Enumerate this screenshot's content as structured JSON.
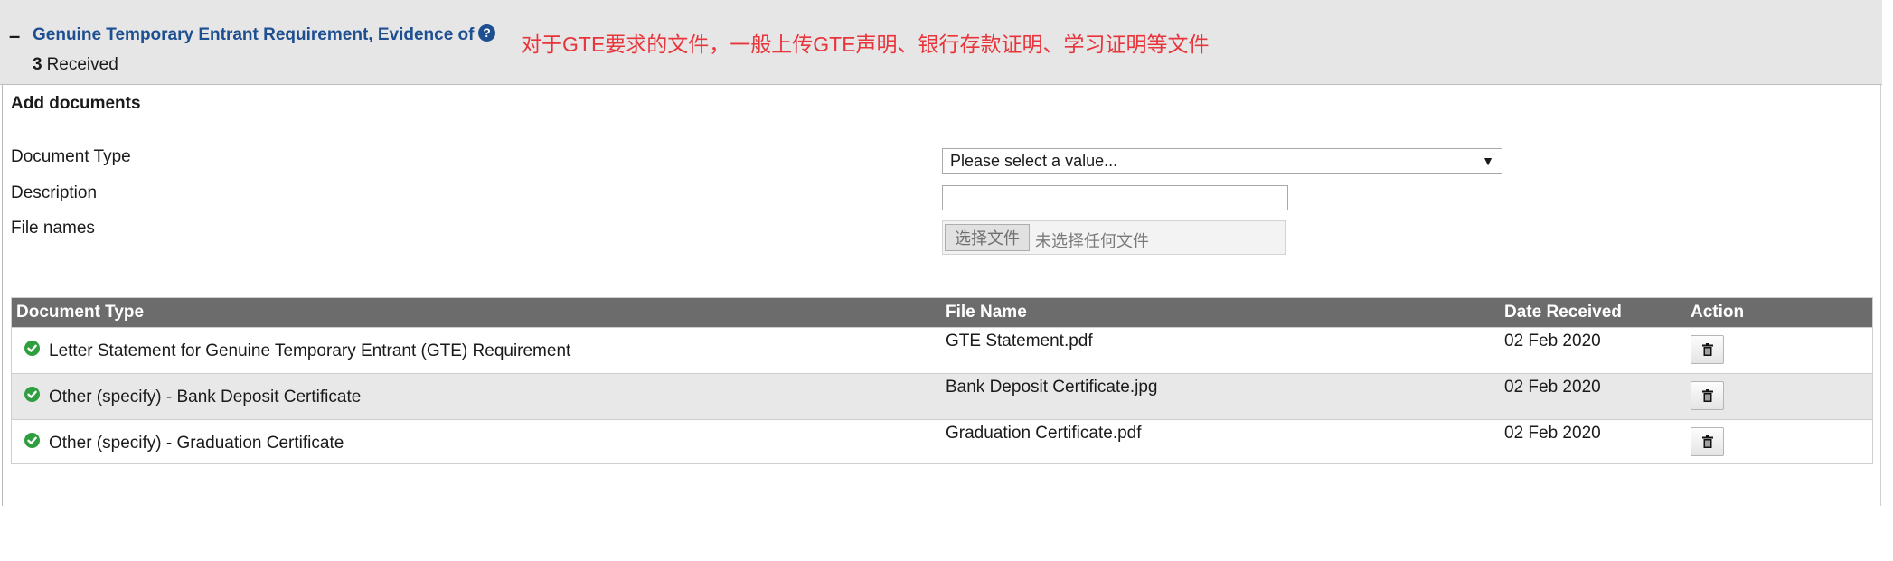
{
  "section": {
    "toggle": "–",
    "title": "Genuine Temporary Entrant Requirement, Evidence of",
    "help_icon": "question-circle-icon",
    "annotation": "对于GTE要求的文件，一般上传GTE声明、银行存款证明、学习证明等文件",
    "received_count": "3",
    "received_label": "Received"
  },
  "form": {
    "title": "Add documents",
    "document_type_label": "Document Type",
    "description_label": "Description",
    "file_names_label": "File names",
    "document_type_value": "Please select a value...",
    "description_value": "",
    "file_button": "选择文件",
    "file_none": "未选择任何文件"
  },
  "table": {
    "headers": {
      "document_type": "Document Type",
      "file_name": "File Name",
      "date_received": "Date Received",
      "action": "Action"
    },
    "rows": [
      {
        "document_type": "Letter Statement for Genuine Temporary Entrant (GTE) Requirement",
        "file_name": "GTE Statement.pdf",
        "date_received": "02 Feb 2020",
        "status_icon": "check-circle-icon",
        "action_icon": "trash-icon"
      },
      {
        "document_type": "Other (specify) - Bank Deposit Certificate",
        "file_name": "Bank Deposit Certificate.jpg",
        "date_received": "02 Feb 2020",
        "status_icon": "check-circle-icon",
        "action_icon": "trash-icon"
      },
      {
        "document_type": "Other (specify) - Graduation Certificate",
        "file_name": "Graduation Certificate.pdf",
        "date_received": "02 Feb 2020",
        "status_icon": "check-circle-icon",
        "action_icon": "trash-icon"
      }
    ]
  },
  "colors": {
    "title_blue": "#1d4f91",
    "annotation_red": "#e8353c",
    "header_gray": "#6c6c6c",
    "check_green": "#2e9e3f"
  }
}
